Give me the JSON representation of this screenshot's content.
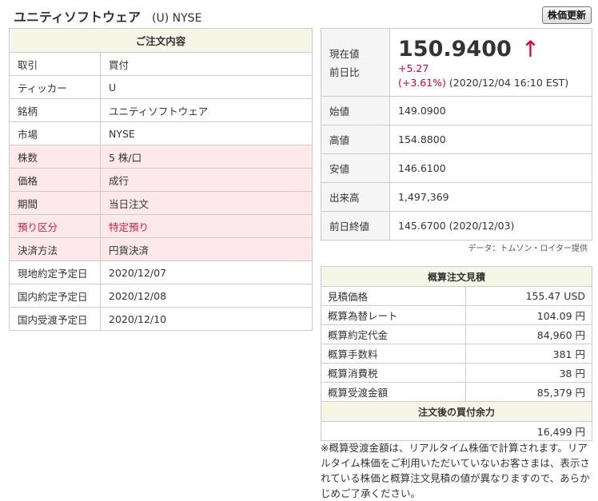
{
  "header": {
    "company": "ユニティソフトウェア",
    "symbol_market": "(U) NYSE",
    "refresh_label": "株価更新"
  },
  "order": {
    "title": "ご注文内容",
    "rows": [
      {
        "label": "取引",
        "value": "買付",
        "style": ""
      },
      {
        "label": "ティッカー",
        "value": "U",
        "style": ""
      },
      {
        "label": "銘柄",
        "value": "ユニティソフトウェア",
        "style": ""
      },
      {
        "label": "市場",
        "value": "NYSE",
        "style": ""
      },
      {
        "label": "株数",
        "value": "5 株/口",
        "style": "pink"
      },
      {
        "label": "価格",
        "value": "成行",
        "style": "pink"
      },
      {
        "label": "期間",
        "value": "当日注文",
        "style": "pink"
      },
      {
        "label": "預り区分",
        "value": "特定預り",
        "style": "pink red"
      },
      {
        "label": "決済方法",
        "value": "円貨決済",
        "style": "pink"
      },
      {
        "label": "現地約定予定日",
        "value": "2020/12/07",
        "style": ""
      },
      {
        "label": "国内約定予定日",
        "value": "2020/12/08",
        "style": ""
      },
      {
        "label": "国内受渡予定日",
        "value": "2020/12/10",
        "style": ""
      }
    ]
  },
  "quote": {
    "label_current": "現在値",
    "label_change": "前日比",
    "price": "150.9400",
    "arrow": "↑",
    "change": "+5.27",
    "change_pct": "(+3.61%)",
    "timestamp": "(2020/12/04 16:10 EST)",
    "rows": [
      {
        "label": "始値",
        "value": "149.0900"
      },
      {
        "label": "高値",
        "value": "154.8800"
      },
      {
        "label": "安値",
        "value": "146.6100"
      },
      {
        "label": "出来高",
        "value": "1,497,369"
      },
      {
        "label": "前日終値",
        "value": "145.6700 (2020/12/03)"
      }
    ],
    "credit": "データ：トムソン・ロイター提供"
  },
  "estimate": {
    "title": "概算注文見積",
    "rows": [
      {
        "label": "見積価格",
        "value": "155.47 USD"
      },
      {
        "label": "概算為替レート",
        "value": "104.09 円"
      },
      {
        "label": "概算約定代金",
        "value": "84,960 円"
      },
      {
        "label": "概算手数料",
        "value": "381 円"
      },
      {
        "label": "概算消費税",
        "value": "38 円"
      },
      {
        "label": "概算受渡金額",
        "value": "85,379 円"
      }
    ],
    "buying_power_title": "注文後の買付余力",
    "buying_power_value": "16,499 円",
    "note": "※概算受渡金額は、リアルタイム株価で計算されます。リアルタイム株価をご利用いただいていないお客さまは、表示されている株価と概算注文見積の値が異なりますので、あらかじめご了承ください。"
  },
  "colors": {
    "up": "#e0002a",
    "pink_row": "#fde8ec",
    "header_bg": "#f6f6e6"
  }
}
